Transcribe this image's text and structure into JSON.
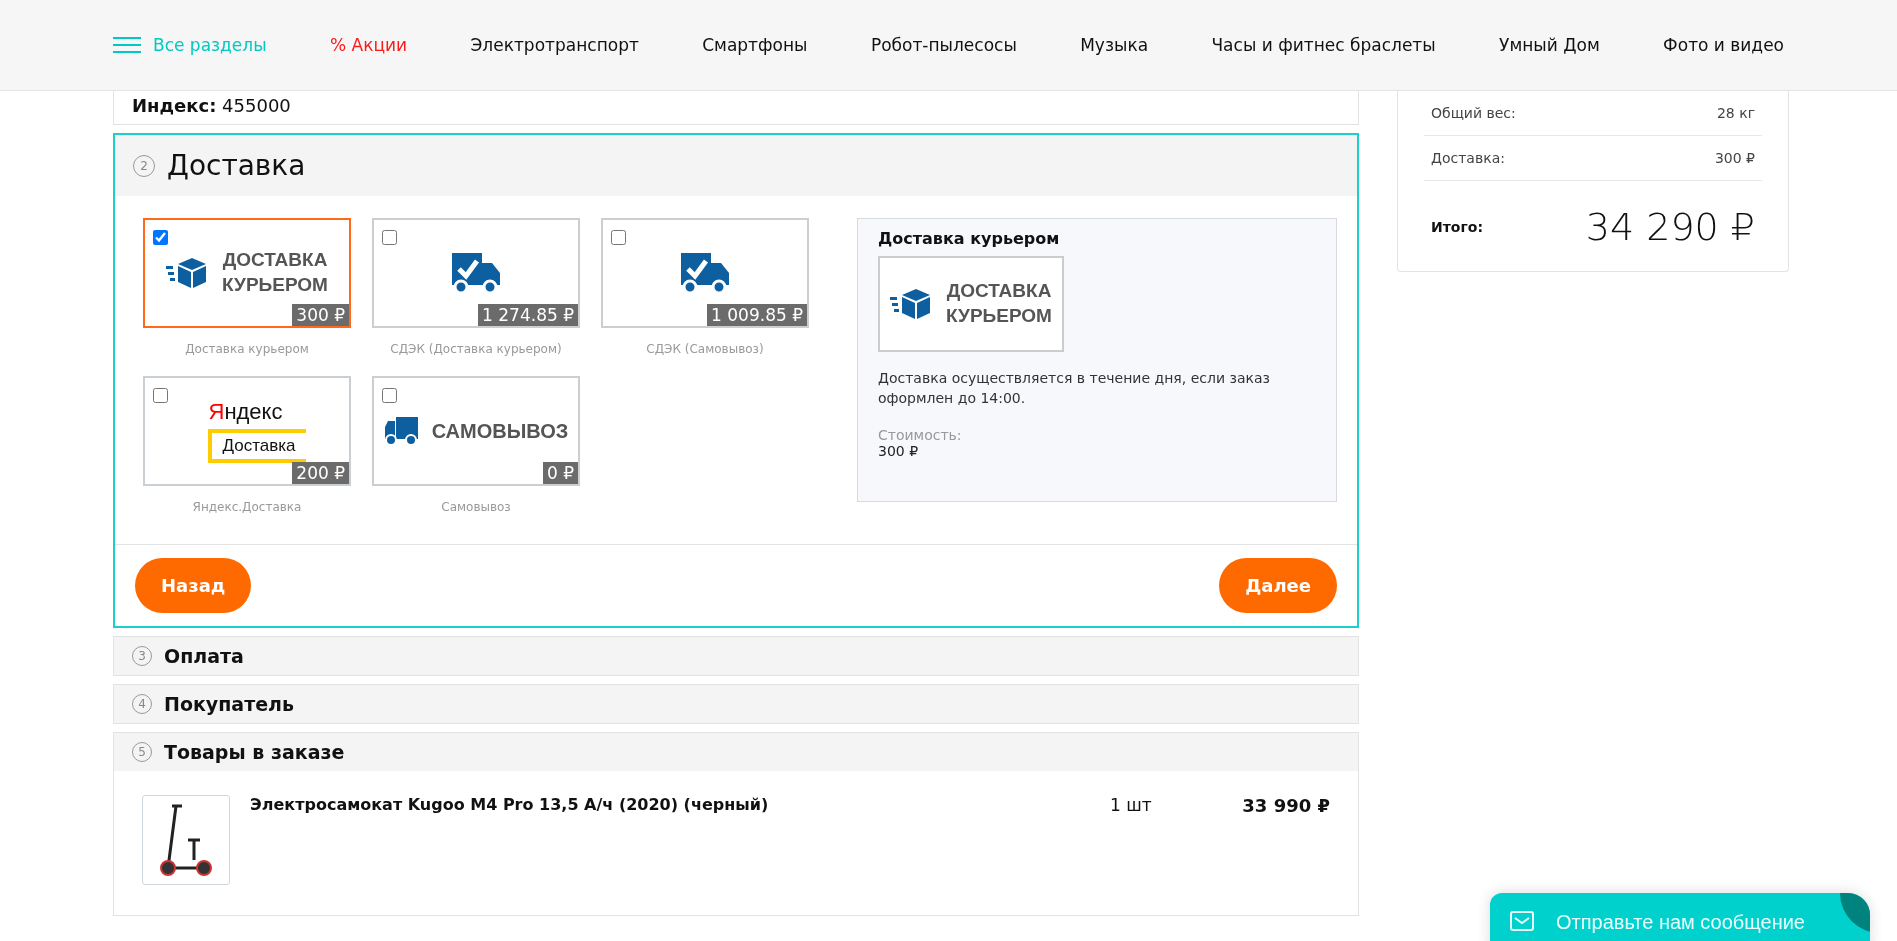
{
  "nav": [
    {
      "kind": "menu",
      "label": "Все разделы"
    },
    {
      "kind": "promo",
      "label": "% Акции"
    },
    {
      "kind": "link",
      "label": "Электротранспорт"
    },
    {
      "kind": "link",
      "label": "Смартфоны"
    },
    {
      "kind": "link",
      "label": "Робот-пылесосы"
    },
    {
      "kind": "link",
      "label": "Музыка"
    },
    {
      "kind": "link",
      "label": "Часы и фитнес браслеты"
    },
    {
      "kind": "link",
      "label": "Умный Дом"
    },
    {
      "kind": "link",
      "label": "Фото и видео"
    }
  ],
  "address": {
    "label": "Индекс:",
    "value": "455000"
  },
  "delivery": {
    "number": "2",
    "title": "Доставка",
    "options": [
      {
        "kind": "courier",
        "checked": true,
        "logo_text": [
          "ДОСТАВКА",
          "КУРЬЕРОМ"
        ],
        "price": "300 ₽",
        "caption": "Доставка курьером"
      },
      {
        "kind": "truck",
        "checked": false,
        "price": "1 274.85 ₽",
        "caption": "СДЭК (Доставка курьером)"
      },
      {
        "kind": "truck",
        "checked": false,
        "price": "1 009.85 ₽",
        "caption": "СДЭК (Самовывоз)"
      },
      {
        "kind": "yandex",
        "checked": false,
        "logo_text": [
          "Яндекс",
          "Доставка"
        ],
        "price": "200 ₽",
        "caption": "Яндекс.Доставка"
      },
      {
        "kind": "pickup",
        "checked": false,
        "logo_text": [
          "САМОВЫВОЗ"
        ],
        "price": "0 ₽",
        "caption": "Самовывоз"
      }
    ],
    "info": {
      "title": "Доставка курьером",
      "logo_text": [
        "ДОСТАВКА",
        "КУРЬЕРОМ"
      ],
      "description": "Доставка осуществляется в течение дня, если заказ оформлен до 14:00.",
      "cost_label": "Стоимость:",
      "cost": "300 ₽"
    },
    "back": "Назад",
    "next": "Далее"
  },
  "sections": [
    {
      "number": "3",
      "title": "Оплата"
    },
    {
      "number": "4",
      "title": "Покупатель"
    },
    {
      "number": "5",
      "title": "Товары в заказе"
    }
  ],
  "order_items": [
    {
      "name": "Электросамокат Kugoo M4 Pro 13,5 А/ч (2020) (черный)",
      "qty": "1 шт",
      "price": "33 990 ₽"
    }
  ],
  "summary": {
    "rows": [
      {
        "label": "Общий вес:",
        "value": "28 кг"
      },
      {
        "label": "Доставка:",
        "value": "300 ₽"
      }
    ],
    "total_label": "Итого:",
    "total": "34 290 ₽"
  },
  "chat": {
    "label": "Отправьте нам сообщение"
  }
}
